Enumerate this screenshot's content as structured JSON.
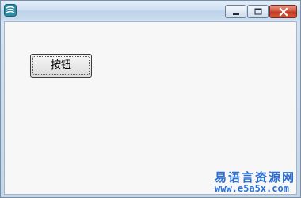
{
  "window": {
    "controls": {
      "minimize_icon": "minimize-icon",
      "maximize_icon": "maximize-icon",
      "close_icon": "close-icon"
    }
  },
  "content": {
    "button_label": "按钮"
  },
  "watermark": {
    "title": "易语言资源网",
    "url": "www.e5a5x.com"
  },
  "colors": {
    "titlebar": "#cfe0f2",
    "close_button": "#c23a22",
    "watermark": "#2b6fd6",
    "client_bg": "#f7f7f7"
  }
}
